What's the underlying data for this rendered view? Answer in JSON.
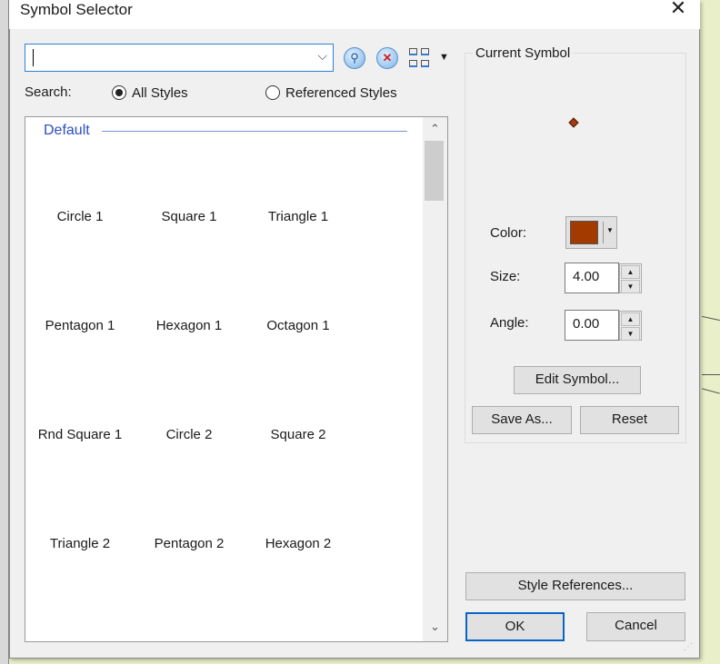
{
  "window": {
    "title": "Symbol Selector",
    "close_icon": "close-icon"
  },
  "search": {
    "value": "",
    "search_label": "Search:",
    "options": [
      {
        "label": "All Styles",
        "selected": true
      },
      {
        "label": "Referenced Styles",
        "selected": false
      }
    ]
  },
  "list": {
    "group_label": "Default",
    "items": [
      "Circle 1",
      "Square 1",
      "Triangle 1",
      "Pentagon 1",
      "Hexagon 1",
      "Octagon 1",
      "Rnd Square 1",
      "Circle 2",
      "Square 2",
      "Triangle 2",
      "Pentagon 2",
      "Hexagon 2"
    ]
  },
  "current_symbol": {
    "label": "Current Symbol",
    "color_label": "Color:",
    "color": "#a33a00",
    "size_label": "Size:",
    "size": "4.00",
    "angle_label": "Angle:",
    "angle": "0.00",
    "edit_button": "Edit Symbol...",
    "save_as_button": "Save As...",
    "reset_button": "Reset"
  },
  "footer": {
    "style_references_button": "Style References...",
    "ok_button": "OK",
    "cancel_button": "Cancel"
  }
}
